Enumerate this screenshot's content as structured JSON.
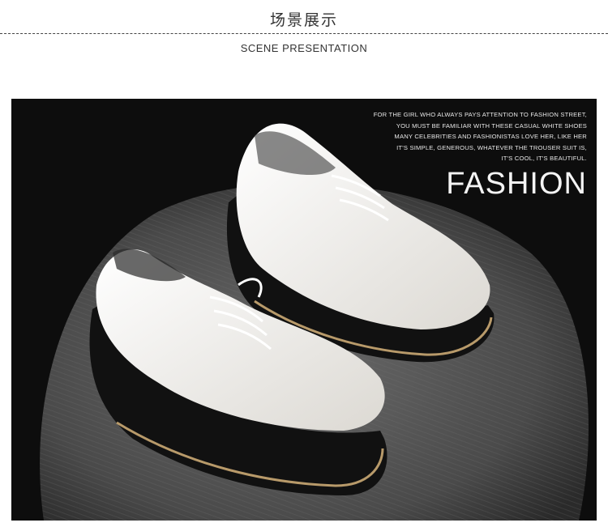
{
  "header": {
    "title_cn": "场景展示",
    "title_en": "SCENE PRESENTATION"
  },
  "photo": {
    "subject": "white platform lace-up shoes on grey chair",
    "tagline_lines": [
      "FOR THE GIRL WHO ALWAYS PAYS ATTENTION TO FASHION STREET,",
      "YOU MUST BE FAMILIAR WITH THESE CASUAL WHITE SHOES",
      "MANY CELEBRITIES AND FASHIONISTAS LOVE HER, LIKE HER",
      "IT'S SIMPLE, GENEROUS, WHATEVER THE TROUSER SUIT IS,",
      "IT'S COOL, IT'S BEAUTIFUL."
    ],
    "headline": "FASHION"
  },
  "colors": {
    "background": "#0d0d0d",
    "chair": "#5a5a5a",
    "shoe_upper": "#f2f0ec",
    "sole": "#111111"
  }
}
